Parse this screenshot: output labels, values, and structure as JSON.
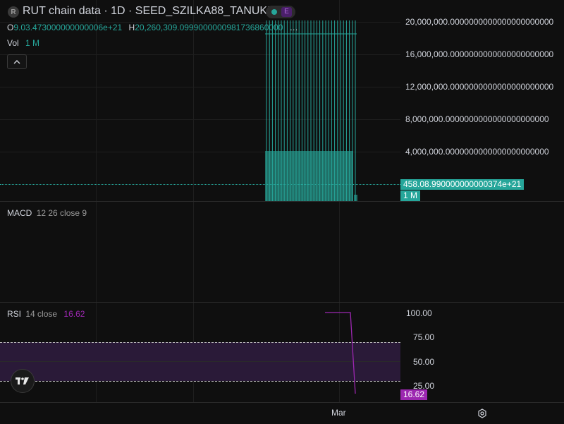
{
  "header": {
    "symbol_icon_letter": "R",
    "title": "RUT chain data · 1D · SEED_SZILKA88_TANUKI",
    "exchange_badge": "E",
    "ohlc": {
      "o_label": "O",
      "o_value": "9.03.473000000000006e+21",
      "h_label": "H",
      "h_value": "20,260,309.0999000000981736860000",
      "more": "…"
    },
    "volume": {
      "label": "Vol",
      "value": "1 M"
    }
  },
  "price_axis": {
    "ticks": [
      "20,000,000.0000000000000000000000",
      "16,000,000.0000000000000000000000",
      "12,000,000.0000000000000000000000",
      "8,000,000.0000000000000000000000",
      "4,000,000.0000000000000000000000"
    ],
    "last_price": "458.08.990000000000374e+21",
    "volume_badge": "1 M"
  },
  "macd": {
    "label": "MACD",
    "params": "12 26 close 9"
  },
  "rsi": {
    "label": "RSI",
    "params": "14 close",
    "value": "16.62",
    "ticks": [
      "100.00",
      "75.00",
      "50.00",
      "25.00"
    ]
  },
  "time_axis": {
    "label": "Mar"
  },
  "colors": {
    "background": "#0f0f0f",
    "up": "#26a69a",
    "rsi_line": "#9c27b0",
    "rsi_band": "#2a1a38"
  },
  "icons": {
    "symbol": "symbol-logo-icon",
    "collapse": "chevron-up-icon",
    "logo": "tradingview-logo-icon",
    "settings": "gear-icon"
  }
}
